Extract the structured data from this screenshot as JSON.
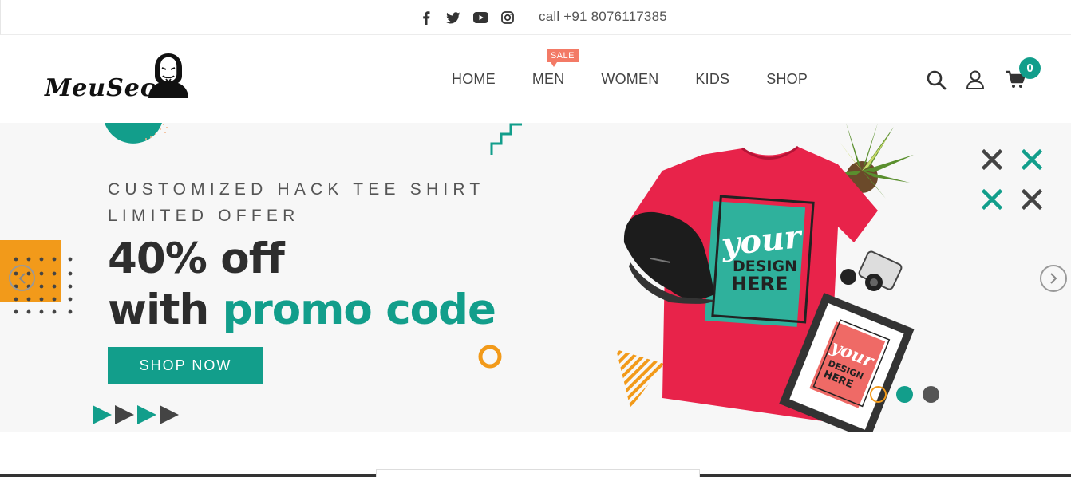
{
  "topbar": {
    "social_icons": [
      "facebook-icon",
      "twitter-icon",
      "youtube-icon",
      "instagram-icon"
    ],
    "phone": "call +91 8076117385"
  },
  "header": {
    "logo_text": "MeuSec",
    "nav": [
      {
        "label": "HOME"
      },
      {
        "label": "MEN",
        "badge": "SALE"
      },
      {
        "label": "WOMEN"
      },
      {
        "label": "KIDS"
      },
      {
        "label": "SHOP"
      }
    ],
    "icons": [
      "search-icon",
      "user-icon",
      "cart-icon"
    ],
    "cart_count": "0"
  },
  "hero": {
    "eyebrow_line1": "CUSTOMIZED HACK TEE SHIRT",
    "eyebrow_line2": "LIMITED OFFER",
    "headline_line1": "40% off",
    "headline_line2_prefix": "with",
    "headline_line2_accent": "promo code",
    "button_label": "SHOP NOW",
    "tshirt_print": [
      "your",
      "DESIGN",
      "HERE"
    ],
    "frame_print": [
      "your",
      "DESIGN",
      "HERE"
    ],
    "slides_active": 1,
    "slides_total": 3
  },
  "colors": {
    "accent": "#129e8b",
    "sale": "#f37a66",
    "orange": "#f29a1a",
    "shirt": "#e8234a",
    "dark": "#2d2d2d"
  }
}
